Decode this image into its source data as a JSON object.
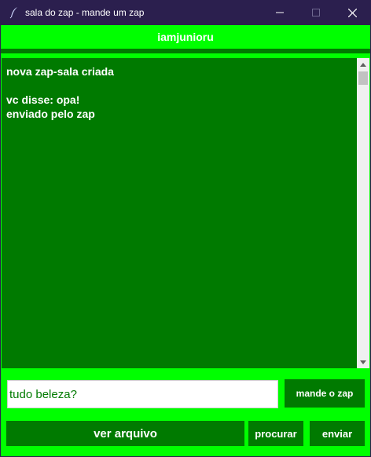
{
  "window": {
    "title": "sala do zap - mande um zap",
    "icons": {
      "app": "feather-icon",
      "minimize": "minimize-icon",
      "maximize": "maximize-icon",
      "close": "close-icon"
    }
  },
  "header": {
    "username": "iamjunioru"
  },
  "chat": {
    "lines": [
      "nova zap-sala criada",
      "",
      "vc disse: opa!",
      "enviado pelo zap"
    ]
  },
  "scrollbar": {
    "icons": {
      "up": "scroll-up-arrow-icon",
      "down": "scroll-down-arrow-icon"
    }
  },
  "composer": {
    "message_value": "tudo beleza?",
    "send_zap_label": "mande o zap"
  },
  "actions": {
    "view_file_label": "ver arquivo",
    "search_label": "procurar",
    "send_label": "enviar"
  },
  "colors": {
    "bright_green": "#00ff00",
    "dark_green": "#007a00",
    "titlebar": "#2b1f4e",
    "text": "#ffffff"
  }
}
